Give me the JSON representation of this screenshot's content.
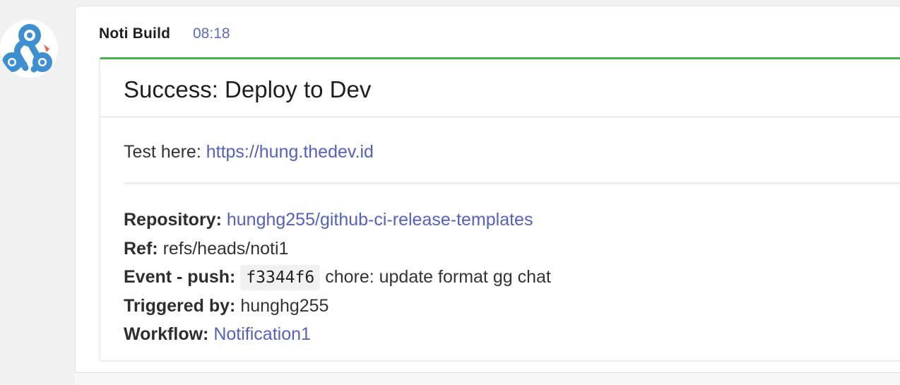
{
  "message": {
    "sender": "Noti Build",
    "time": "08:18",
    "avatar_icon": "webhook-icon"
  },
  "card": {
    "accent_color": "#4caf50",
    "link_color": "#5561c0",
    "title": "Success: Deploy to Dev",
    "test": {
      "label": "Test here: ",
      "url": "https://hung.thedev.id"
    },
    "details": {
      "repository": {
        "label": "Repository:",
        "value": "hunghg255/github-ci-release-templates"
      },
      "ref": {
        "label": "Ref:",
        "value": "refs/heads/noti1"
      },
      "event": {
        "label": "Event - push:",
        "sha": "f3344f6",
        "message": "chore: update format gg chat"
      },
      "triggered_by": {
        "label": "Triggered by:",
        "value": "hunghg255"
      },
      "workflow": {
        "label": "Workflow:",
        "value": "Notification1"
      }
    }
  }
}
